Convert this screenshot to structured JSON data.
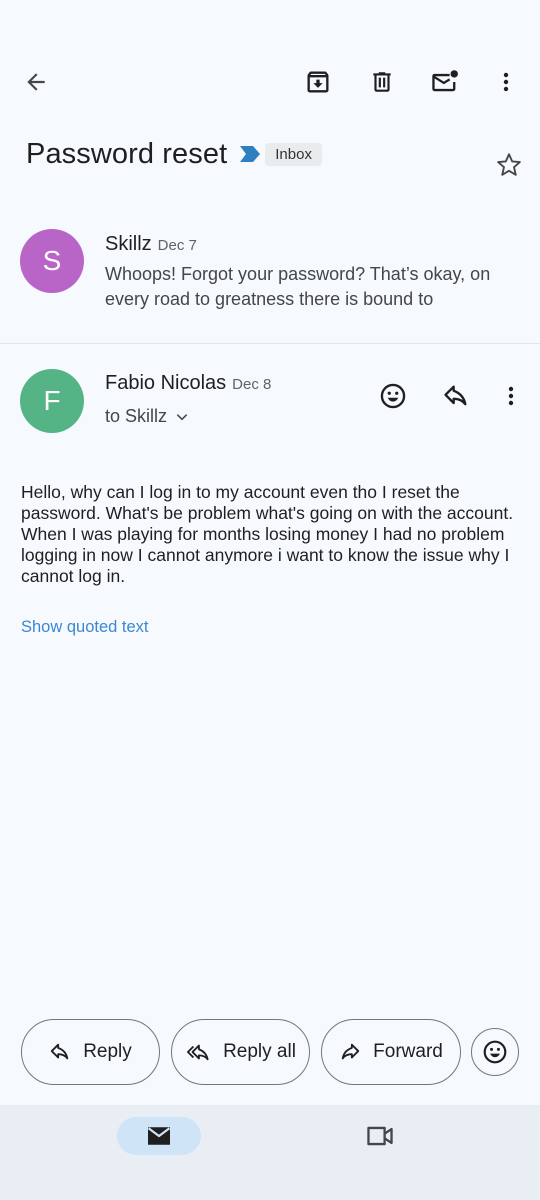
{
  "toolbar": {
    "back_icon": "arrow-left-icon",
    "archive_icon": "archive-icon",
    "delete_icon": "trash-icon",
    "mark_unread_icon": "mail-unread-icon",
    "more_icon": "more-vertical-icon"
  },
  "thread": {
    "subject": "Password reset",
    "label": "Inbox",
    "starred": false
  },
  "messages": [
    {
      "avatar_letter": "S",
      "avatar_color": "#b965c7",
      "sender": "Skillz",
      "date": "Dec 7",
      "snippet": "Whoops! Forgot your password? That’s okay, on every road to greatness there is bound to"
    },
    {
      "avatar_letter": "F",
      "avatar_color": "#55b486",
      "sender": "Fabio Nicolas",
      "date": "Dec 8",
      "to": "to Skillz",
      "body": "Hello, why can I log in to my account even tho I reset the password. What's be problem what's going on with the account. When I was playing for months losing money I had no problem logging in now I cannot anymore i want to know the issue why I cannot log in.",
      "show_quoted": "Show quoted text"
    }
  ],
  "actions": {
    "reply": "Reply",
    "reply_all": "Reply all",
    "forward": "Forward"
  },
  "bottom_nav": {
    "mail_icon": "mail-icon",
    "meet_icon": "video-icon",
    "active": "mail"
  },
  "colors": {
    "background": "#f6f9fd",
    "link": "#3b87d3",
    "nav_active": "#cfe4f7"
  }
}
